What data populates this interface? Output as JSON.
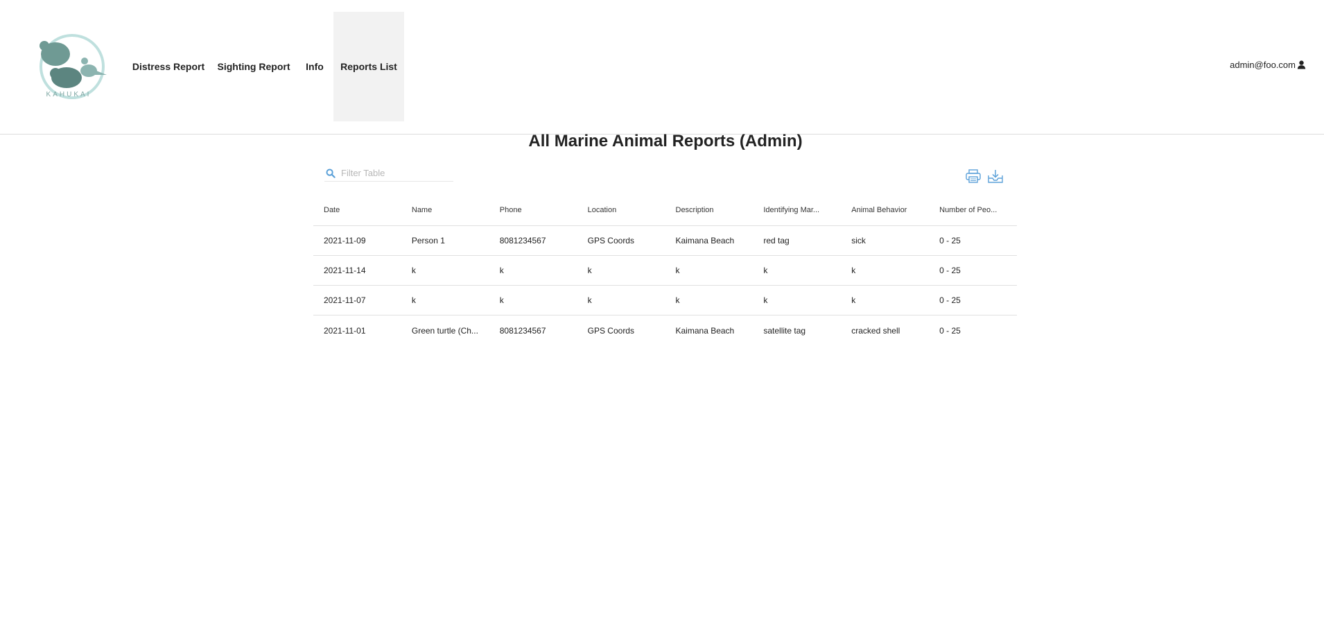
{
  "app": {
    "logo_text": "KAHUKAI"
  },
  "nav": {
    "items": [
      {
        "label": "Distress Report"
      },
      {
        "label": "Sighting Report"
      },
      {
        "label": "Info"
      },
      {
        "label": "Reports List"
      }
    ],
    "active": "Reports List"
  },
  "user": {
    "email": "admin@foo.com"
  },
  "main": {
    "title": "All Marine Animal Reports (Admin)",
    "filter_placeholder": "Filter Table"
  },
  "table": {
    "columns": [
      "Date",
      "Name",
      "Phone",
      "Location",
      "Description",
      "Identifying Mar...",
      "Animal Behavior",
      "Number of Peo..."
    ],
    "rows": [
      [
        "2021-11-09",
        "Person 1",
        "8081234567",
        "GPS Coords",
        "Kaimana Beach",
        "red tag",
        "sick",
        "0 - 25"
      ],
      [
        "2021-11-14",
        "k",
        "k",
        "k",
        "k",
        "k",
        "k",
        "0 - 25"
      ],
      [
        "2021-11-07",
        "k",
        "k",
        "k",
        "k",
        "k",
        "k",
        "0 - 25"
      ],
      [
        "2021-11-01",
        "Green turtle (Ch...",
        "8081234567",
        "GPS Coords",
        "Kaimana Beach",
        "satellite tag",
        "cracked shell",
        "0 - 25"
      ]
    ]
  },
  "colors": {
    "accent": "#5aa0d8",
    "logo": "#6f9a94",
    "active_nav_bg": "#f2f2f2"
  },
  "icons": {
    "filter": "search-icon",
    "user": "user-icon",
    "print": "printer-icon",
    "export": "download-icon"
  }
}
